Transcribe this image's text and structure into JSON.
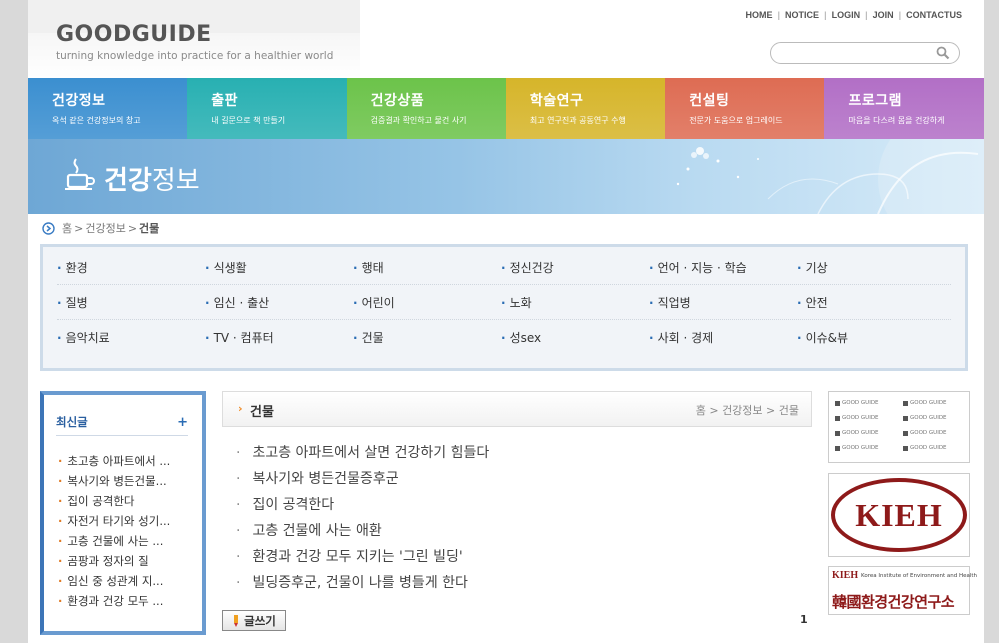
{
  "header": {
    "logo": "GOODGUIDE",
    "tagline": "turning knowledge into practice for a healthier world",
    "top_links": [
      "HOME",
      "NOTICE",
      "LOGIN",
      "JOIN",
      "CONTACTUS"
    ],
    "search_placeholder": ""
  },
  "nav": [
    {
      "title": "건강정보",
      "sub": "옥석 같은 건강정보의 창고",
      "color": "#3b8fd0"
    },
    {
      "title": "출판",
      "sub": "내 길문으로 책 만들기",
      "color": "#28b0b2"
    },
    {
      "title": "건강상품",
      "sub": "검증결과 확인하고 물건 사기",
      "color": "#6cc34a"
    },
    {
      "title": "학술연구",
      "sub": "최고 연구진과 공동연구 수행",
      "color": "#d6b52a"
    },
    {
      "title": "컨설팅",
      "sub": "전문가 도움으로 업그레이드",
      "color": "#de6c53"
    },
    {
      "title": "프로그램",
      "sub": "마음을 다스려 몸을 건강하게",
      "color": "#b26fc6"
    }
  ],
  "banner": {
    "title_bold": "건강",
    "title_rest": "정보"
  },
  "breadcrumb": {
    "home": "홈",
    "section": "건강정보",
    "current": "건물",
    "sep": ">"
  },
  "categories": [
    [
      "환경",
      "식생활",
      "행태",
      "정신건강",
      "언어 · 지능 · 학습",
      "기상"
    ],
    [
      "질병",
      "임신 · 출산",
      "어린이",
      "노화",
      "직업병",
      "안전"
    ],
    [
      "음악치료",
      "TV · 컴퓨터",
      "건물",
      "성sex",
      "사회 · 경제",
      "이슈&뷰"
    ]
  ],
  "sidebar": {
    "title": "최신글",
    "plus": "+",
    "items": [
      "초고층 아파트에서 ...",
      "복사기와 병든건물...",
      "집이 공격한다",
      "자전거 타기와 성기...",
      "고층 건물에 사는 ...",
      "곰팡과 정자의 질",
      "임신 중 성관계 지...",
      "환경과 건강 모두 ..."
    ]
  },
  "content": {
    "title": "건물",
    "crumb": "홈 > 건강정보 > 건물",
    "articles": [
      "초고층 아파트에서 살면 건강하기 힘들다",
      "복사기와 병든건물증후군",
      "집이 공격한다",
      "고층 건물에 사는 애환",
      "환경과 건강 모두 지키는 '그린 빌딩'",
      "빌딩증후군, 건물이 나를 병들게 한다"
    ],
    "write_label": "글쓰기",
    "page": "1"
  },
  "ads": {
    "partners": [
      "GOOD GUIDE",
      "GOOD GUIDE",
      "GOOD GUIDE",
      "GOOD GUIDE",
      "GOOD GUIDE",
      "GOOD GUIDE",
      "GOOD GUIDE",
      "GOOD GUIDE"
    ],
    "kieh_logo": "KIEH",
    "kieh_small": "KIEH",
    "kieh_english": "Korea Institute of Environment and Health",
    "kieh_korean": "韓國환경건강연구소"
  }
}
